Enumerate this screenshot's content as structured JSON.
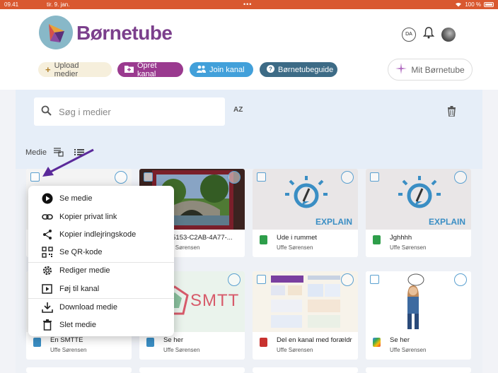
{
  "status_bar": {
    "time": "09.41",
    "date": "tir. 9. jan.",
    "battery": "100 %"
  },
  "brand": {
    "name": "Børnetube",
    "color": "#7b3f8c"
  },
  "header": {
    "language": "DA",
    "buttons": {
      "upload": "Upload medier",
      "create_channel": "Opret kanal",
      "join_channel": "Join kanal",
      "guide": "Børnetubeguide",
      "my": "Mit Børnetube"
    }
  },
  "search": {
    "placeholder": "Søg i medier",
    "sort_label": "AZ"
  },
  "toolbar": {
    "media_label": "Medie"
  },
  "context_menu": {
    "items": [
      {
        "label": "Se medie",
        "icon": "play-circle-icon"
      },
      {
        "label": "Kopier privat link",
        "icon": "link-icon"
      },
      {
        "label": "Kopier indlejringskode",
        "icon": "share-icon"
      },
      {
        "label": "Se QR-kode",
        "icon": "qr-code-icon"
      },
      {
        "label": "Rediger medie",
        "icon": "gear-icon"
      },
      {
        "label": "Føj til kanal",
        "icon": "playlist-add-icon"
      },
      {
        "label": "Download medie",
        "icon": "download-icon"
      },
      {
        "label": "Slet medie",
        "icon": "trash-icon"
      }
    ]
  },
  "cards": [
    {
      "title": "",
      "owner": ""
    },
    {
      "title": "4D5153-C2AB-4A77-...",
      "owner": "Uffe Sørensen"
    },
    {
      "title": "Ude i rummet",
      "owner": "Uffe Sørensen",
      "thumb_text": "EXPLAIN"
    },
    {
      "title": "Jghhhh",
      "owner": "Uffe Sørensen",
      "thumb_text": "EXPLAIN"
    },
    {
      "title": "En SMTTE",
      "owner": "Uffe Sørensen"
    },
    {
      "title": "Se her",
      "owner": "Uffe Sørensen",
      "thumb_text": "SMTT"
    },
    {
      "title": "Del en kanal med forældre",
      "owner": "Uffe Sørensen"
    },
    {
      "title": "Se her",
      "owner": "Uffe Sørensen"
    }
  ]
}
